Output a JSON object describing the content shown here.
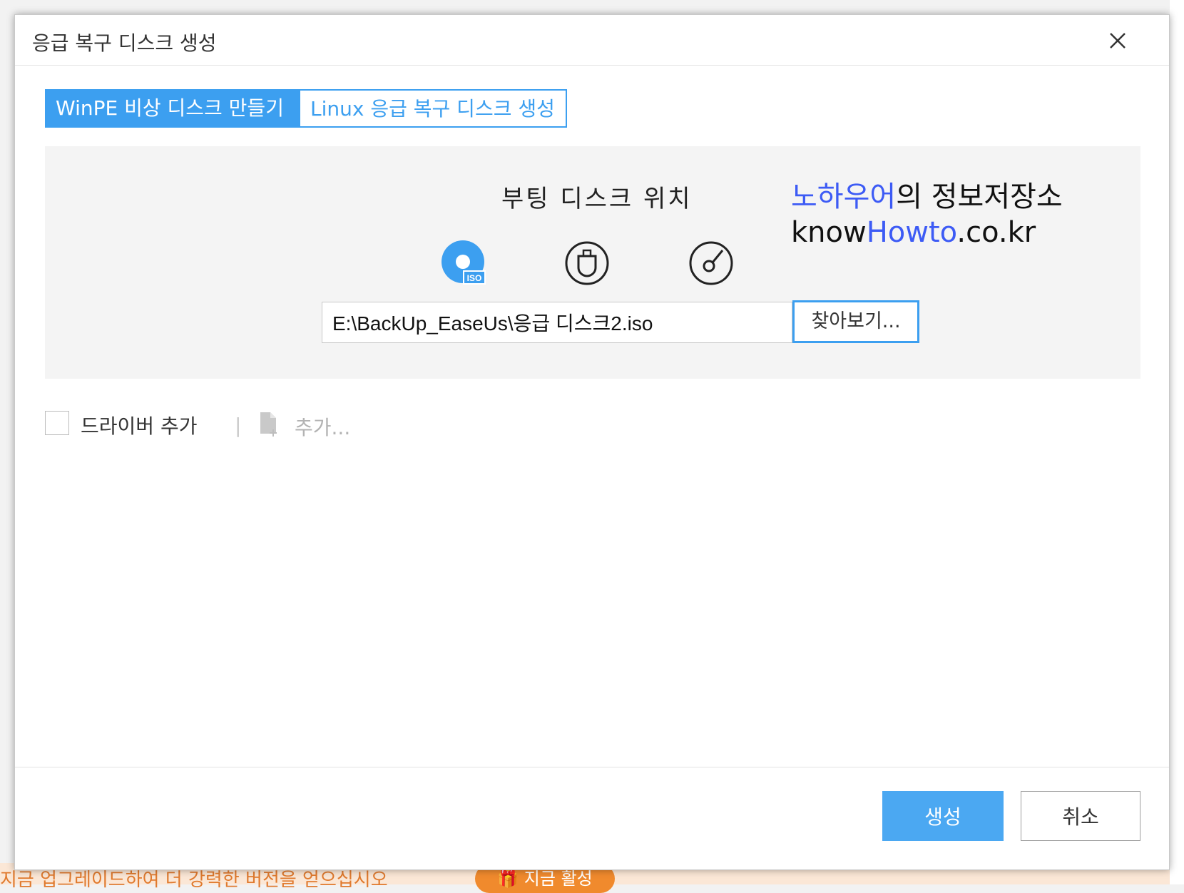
{
  "background": {
    "banner_text": "지금 업그레이드하여 더 강력한 버전을 얻으십시오",
    "activate_label": "🎁 지금 활성"
  },
  "dialog": {
    "title": "응급 복구 디스크 생성",
    "close_icon": "close-icon"
  },
  "tabs": [
    {
      "label": "WinPE 비상 디스크 만들기",
      "active": true
    },
    {
      "label": "Linux 응급 복구 디스크 생성",
      "active": false
    }
  ],
  "boot_location": {
    "heading": "부팅 디스크 위치",
    "media_options": [
      {
        "icon": "iso-disc-icon",
        "selected": true
      },
      {
        "icon": "usb-drive-icon",
        "selected": false
      },
      {
        "icon": "cd-dvd-icon",
        "selected": false
      }
    ],
    "path_value": "E:\\BackUp_EaseUs\\응급 디스크2.iso",
    "browse_label": "찾아보기..."
  },
  "watermark": {
    "line1_blue": "노하우어",
    "line1_rest": "의 정보저장소",
    "line2_pre": "know",
    "line2_blue": "Howto",
    "line2_post": ".co.kr"
  },
  "driver": {
    "checkbox_label": "드라이버 추가",
    "separator": "|",
    "add_label": "추가...",
    "checked": false
  },
  "footer": {
    "create_label": "생성",
    "cancel_label": "취소"
  },
  "colors": {
    "accent": "#3c9ff0",
    "create_button": "#4ba8f2",
    "watermark_blue": "#3d5bf5",
    "panel_bg": "#f4f4f4"
  }
}
